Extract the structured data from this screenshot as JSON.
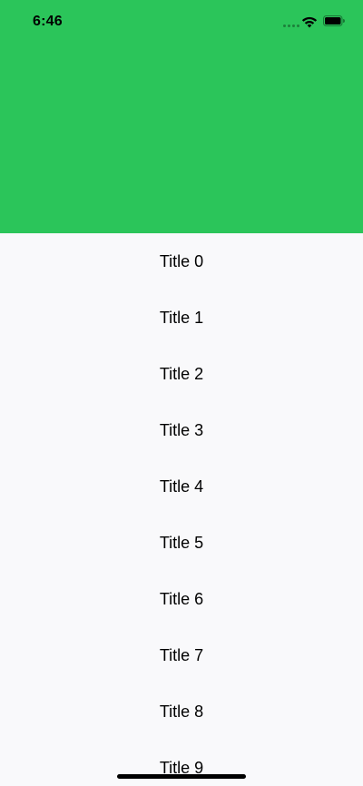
{
  "status_bar": {
    "time": "6:46"
  },
  "header": {
    "color": "#2bc55a"
  },
  "list": {
    "items": [
      {
        "title": "Title 0"
      },
      {
        "title": "Title 1"
      },
      {
        "title": "Title 2"
      },
      {
        "title": "Title 3"
      },
      {
        "title": "Title 4"
      },
      {
        "title": "Title 5"
      },
      {
        "title": "Title 6"
      },
      {
        "title": "Title 7"
      },
      {
        "title": "Title 8"
      },
      {
        "title": "Title 9"
      }
    ]
  },
  "icons": {
    "signal": "signal-icon",
    "wifi": "wifi-icon",
    "battery": "battery-icon"
  }
}
